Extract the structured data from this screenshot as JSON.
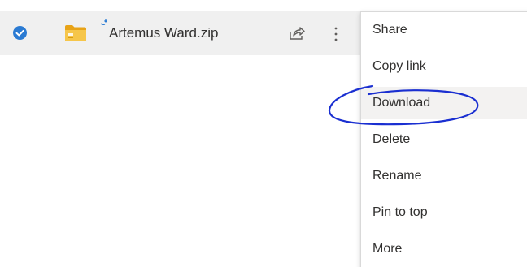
{
  "file_row": {
    "selected": true,
    "file_name": "Artemus Ward.zip",
    "icons": {
      "checkmark": "checkmark-circle-icon",
      "file_type": "zip-folder-icon",
      "sync": "sync-arrow-icon",
      "share": "share-icon",
      "more": "more-vertical-icon"
    }
  },
  "context_menu": {
    "items": [
      {
        "label": "Share"
      },
      {
        "label": "Copy link"
      },
      {
        "label": "Download"
      },
      {
        "label": "Delete"
      },
      {
        "label": "Rename"
      },
      {
        "label": "Pin to top"
      },
      {
        "label": "More"
      }
    ],
    "hovered_index": 2
  },
  "annotation": {
    "type": "hand-drawn-circle",
    "target": "Download",
    "color": "#1a2fd1"
  },
  "colors": {
    "accent": "#2b7bd3",
    "row_background": "#f0f0f0",
    "hover_background": "#f3f2f1",
    "folder_yellow": "#f6b91a",
    "text": "#323130"
  }
}
